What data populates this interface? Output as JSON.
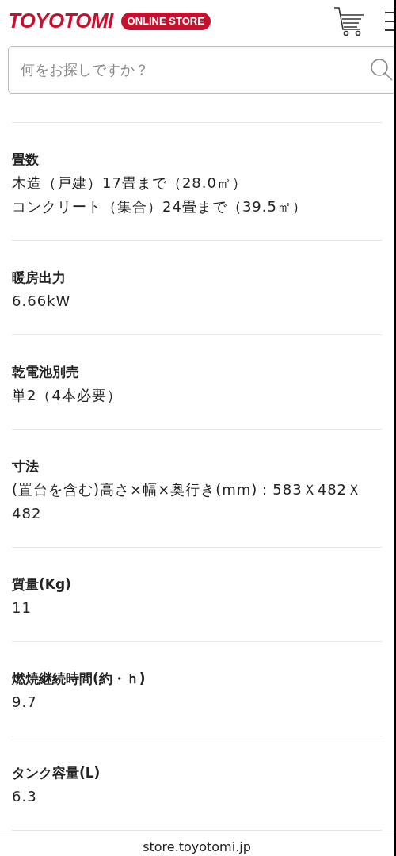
{
  "header": {
    "logo": "TOYOTOMI",
    "badge": "ONLINE STORE"
  },
  "search": {
    "placeholder": "何をお探しですか？"
  },
  "specs": [
    {
      "label": "畳数",
      "values": [
        "木造（戸建）17畳まで（28.0㎡）",
        "コンクリート（集合）24畳まで（39.5㎡）"
      ]
    },
    {
      "label": "暖房出力",
      "values": [
        "6.66kW"
      ]
    },
    {
      "label": "乾電池別売",
      "values": [
        "単2（4本必要）"
      ]
    },
    {
      "label": "寸法",
      "values": [
        "(置台を含む)高さ×幅×奥行き(mm)：583Ｘ482Ｘ482"
      ]
    },
    {
      "label": "質量(Kg)",
      "values": [
        "11"
      ]
    },
    {
      "label": "燃焼継続時間(約・ｈ)",
      "values": [
        "9.7"
      ]
    },
    {
      "label": "タンク容量(L)",
      "values": [
        "6.3"
      ]
    }
  ],
  "address_bar": {
    "url": "store.toyotomi.jp"
  }
}
